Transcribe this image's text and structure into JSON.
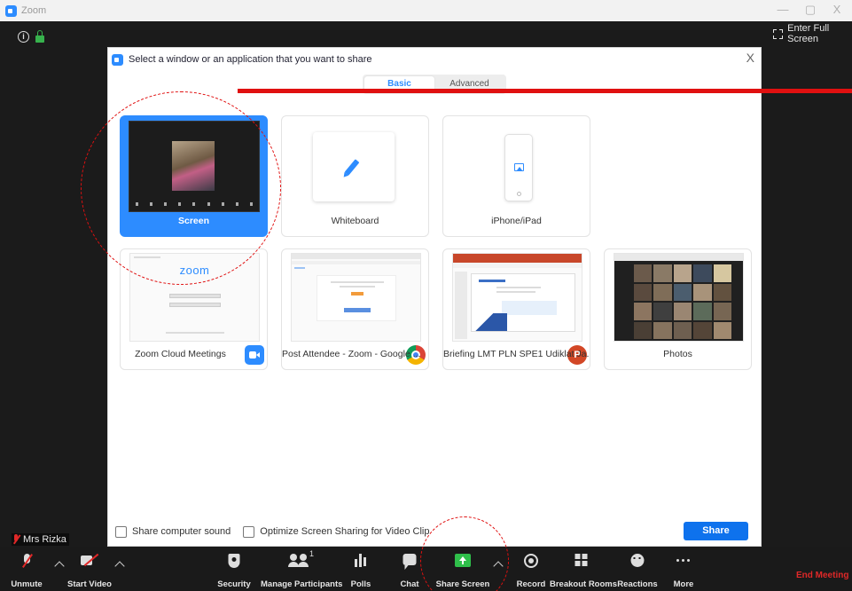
{
  "window": {
    "title": "Zoom",
    "minimize": "—",
    "maximize": "▢",
    "close": "X"
  },
  "meeting": {
    "info_glyph": "i",
    "fullscreen_label": "Enter Full Screen",
    "speaker_name": "Mrs Rizka"
  },
  "dialog": {
    "title": "Select a window or an application that you want to share",
    "close_glyph": "X",
    "tabs": [
      {
        "label": "Basic",
        "active": true
      },
      {
        "label": "Advanced",
        "active": false
      }
    ],
    "tiles": [
      {
        "label": "Screen",
        "selected": true
      },
      {
        "label": "Whiteboard",
        "selected": false
      },
      {
        "label": "iPhone/iPad",
        "selected": false
      },
      {
        "label": "Zoom Cloud Meetings",
        "selected": false,
        "thumb_text": "zoom"
      },
      {
        "label": "Post Attendee - Zoom - Google ...",
        "selected": false
      },
      {
        "label": "Briefing LMT PLN SPE1 Udiklat Ja...",
        "selected": false,
        "badge_text": "P"
      },
      {
        "label": "Photos",
        "selected": false
      }
    ],
    "footer": {
      "share_sound_label": "Share computer sound",
      "optimize_label": "Optimize Screen Sharing for Video Clip",
      "share_button": "Share"
    }
  },
  "toolbar": {
    "unmute": "Unmute",
    "start_video": "Start Video",
    "security": "Security",
    "manage_participants": "Manage Participants",
    "participant_count": "1",
    "polls": "Polls",
    "chat": "Chat",
    "share_screen": "Share Screen",
    "record": "Record",
    "breakout_rooms": "Breakout Rooms",
    "reactions": "Reactions",
    "more": "More",
    "end_meeting": "End Meeting"
  },
  "colors": {
    "accent": "#2d8cff",
    "share_button": "#0e72ed",
    "share_screen_icon": "#2fbf4a",
    "end_meeting": "#e02828",
    "annotation": "#e01010"
  }
}
